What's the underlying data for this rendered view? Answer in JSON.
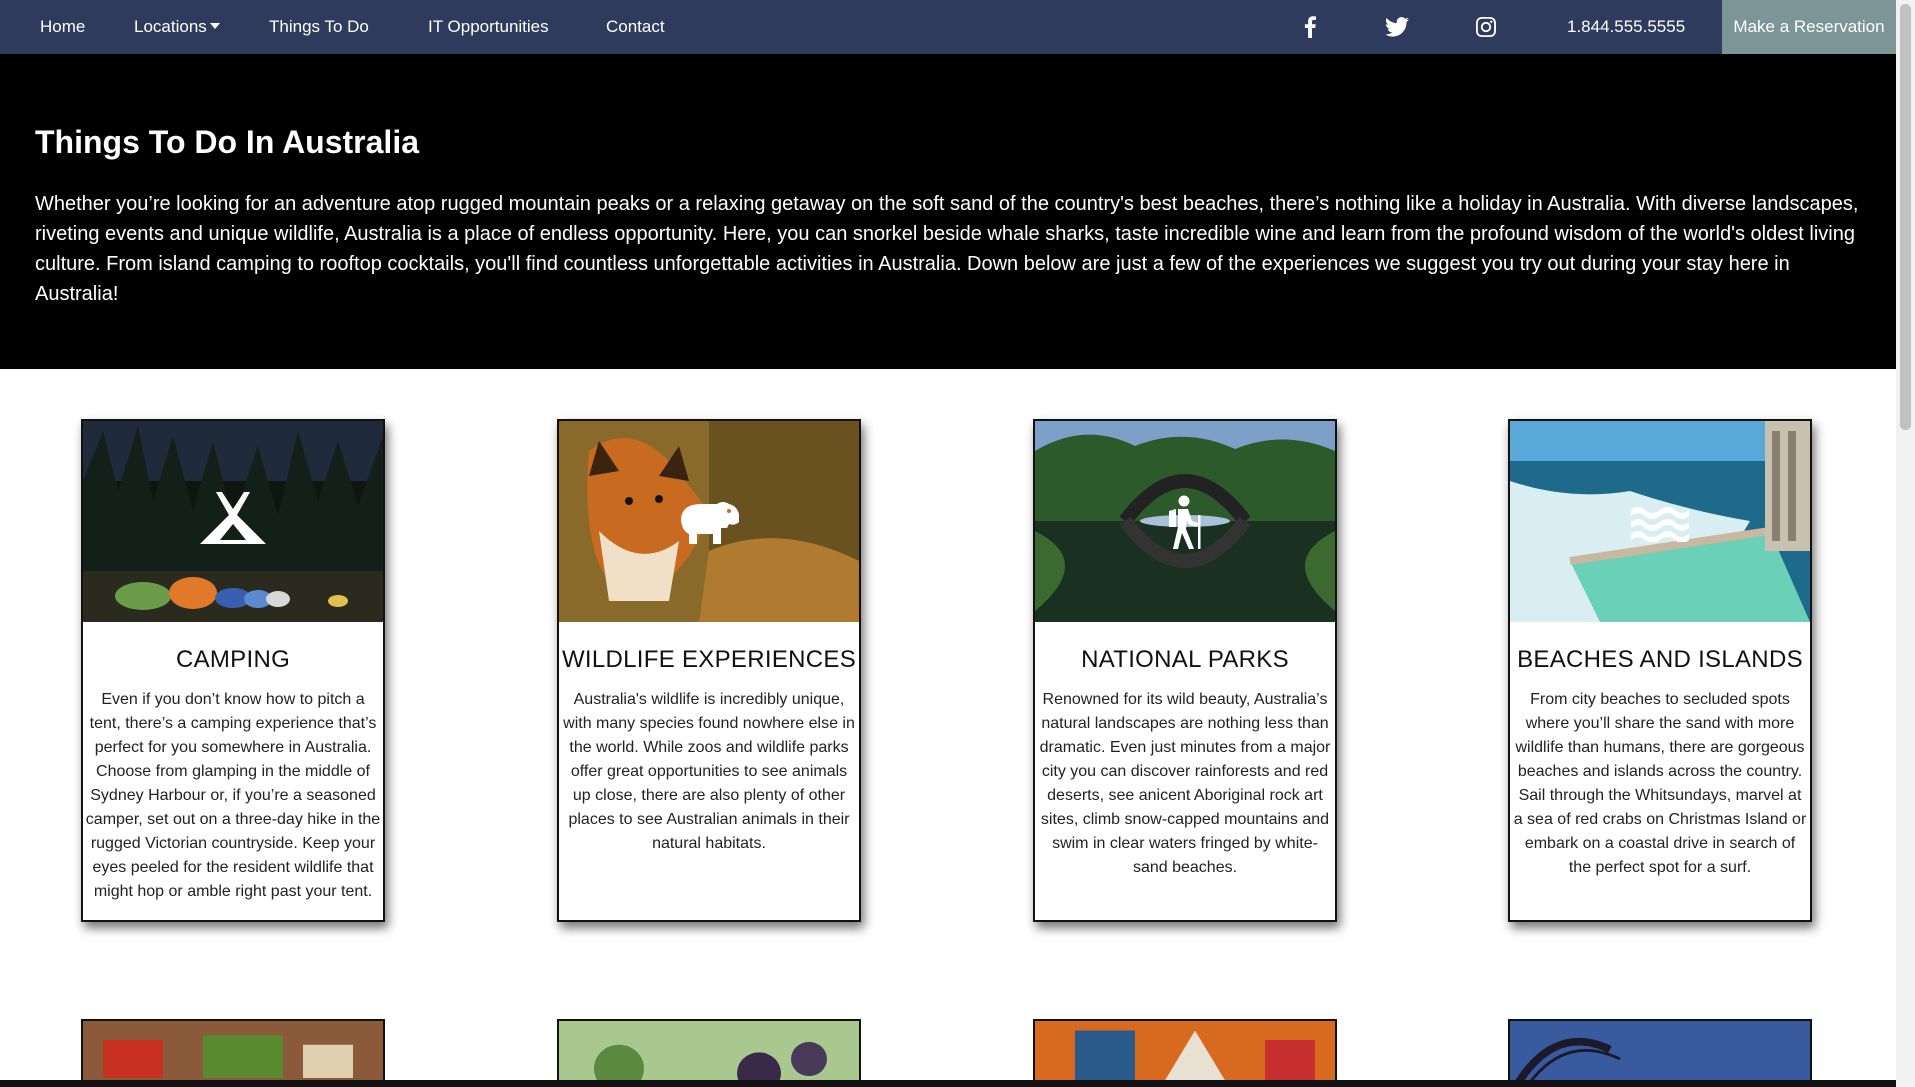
{
  "nav": {
    "home": "Home",
    "locations": "Locations",
    "things_to_do": "Things To Do",
    "it_opportunities": "IT Opportunities",
    "contact": "Contact",
    "phone": "1.844.555.5555",
    "reserve": "Make a Reservation",
    "social": [
      "facebook-icon",
      "twitter-icon",
      "instagram-icon"
    ]
  },
  "hero": {
    "title": "Things To Do In Australia",
    "text": "Whether you’re looking for an adventure atop rugged mountain peaks or a relaxing getaway on the soft sand of the country's best beaches, there’s nothing like a holiday in Australia. With diverse landscapes, riveting events and unique wildlife, Australia is a place of endless opportunity. Here, you can snorkel beside whale sharks, taste incredible wine and learn from the profound wisdom of the world's oldest living culture. From island camping to rooftop cocktails, you'll find countless unforgettable activities in Australia. Down below are just a few of the experiences we suggest you try out during your stay here in Australia!"
  },
  "cards": [
    {
      "title": "CAMPING",
      "icon": "tent-icon",
      "text": "Even if you don’t know how to pitch a tent, there’s a camping experience that’s perfect for you somewhere in Australia. Choose from glamping in the middle of Sydney Harbour or, if you’re a seasoned camper, set out on a three-day hike in the rugged Victorian countryside. Keep your eyes peeled for the resident wildlife that might hop or amble right past your tent."
    },
    {
      "title": "WILDLIFE EXPERIENCES",
      "icon": "hippo-icon",
      "text": "Australia's wildlife is incredibly unique, with many species found nowhere else in the world. While zoos and wildlife parks offer great opportunities to see animals up close, there are also plenty of other places to see Australian animals in their natural habitats."
    },
    {
      "title": "NATIONAL PARKS",
      "icon": "hiking-icon",
      "text": "Renowned for its wild beauty, Australia’s natural landscapes are nothing less than dramatic. Even just minutes from a major city you can discover rainforests and red deserts, see anicent Aboriginal rock art sites, climb snow-capped mountains and swim in clear waters fringed by white-sand beaches."
    },
    {
      "title": "BEACHES AND ISLANDS",
      "icon": "water-icon",
      "text": "From city beaches to secluded spots where you’ll share the sand with more wildlife than humans, there are gorgeous beaches and islands across the country. Sail through the Whitsundays, marvel at a sea of red crabs on Christmas Island or embark on a coastal drive in search of the perfect spot for a surf."
    }
  ],
  "colors": {
    "navbar": "#2f3b5c",
    "reserve_button": "#7c9598",
    "hero_bg": "#000000"
  }
}
